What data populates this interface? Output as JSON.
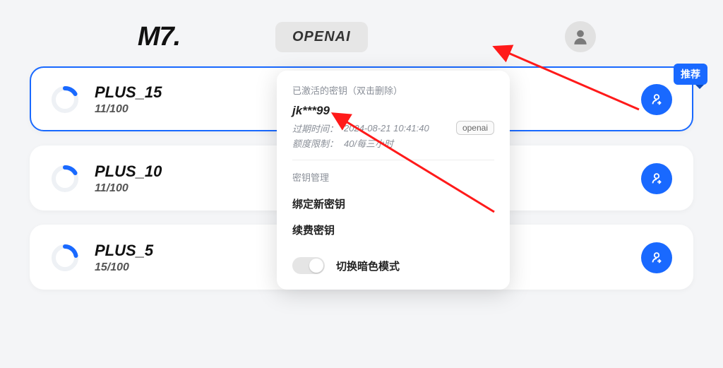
{
  "header": {
    "logo": "M7.",
    "model": "OPENAI"
  },
  "recommend_label": "推荐",
  "plans": [
    {
      "name": "PLUS_15",
      "usage": "11/100",
      "selected": true,
      "recommend": true
    },
    {
      "name": "PLUS_10",
      "usage": "11/100",
      "selected": false,
      "recommend": false
    },
    {
      "name": "PLUS_5",
      "usage": "15/100",
      "selected": false,
      "recommend": false
    }
  ],
  "popover": {
    "section_active": "已激活的密钥（双击删除）",
    "key_name": "jk***99",
    "expire_label": "过期时间：",
    "expire_value": "2024-08-21 10:41:40",
    "provider_tag": "openai",
    "limit_label": "额度限制：",
    "limit_value": "40/每三小时",
    "section_manage": "密钥管理",
    "bind_new": "绑定新密钥",
    "renew": "续费密钥",
    "dark_mode": "切换暗色模式"
  }
}
